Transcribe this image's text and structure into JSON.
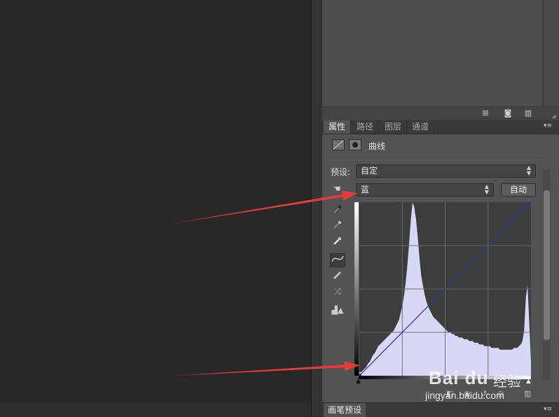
{
  "tabs": [
    {
      "label": "属性",
      "active": true
    },
    {
      "label": "路径",
      "active": false
    },
    {
      "label": "图层",
      "active": false
    },
    {
      "label": "通道",
      "active": false
    }
  ],
  "properties": {
    "title": "曲线",
    "preset_label": "预设:",
    "preset_value": "自定",
    "channel_value": "蓝",
    "auto_button": "自动"
  },
  "bottom_panel": {
    "tab_label": "画笔预设"
  },
  "icons": {
    "top_footer": [
      "new-layer-icon",
      "camera-icon",
      "trash-icon"
    ],
    "tools": [
      "eyedropper-black-icon",
      "eyedropper-gray-icon",
      "eyedropper-white-icon",
      "curve-point-icon",
      "pencil-icon",
      "smooth-icon",
      "clipping-warning-icon"
    ],
    "header": [
      "curves-adjustment-icon",
      "mask-icon"
    ]
  },
  "curve": {
    "channel_color": "#2f2fa0",
    "histogram_color": "#d8d8f6",
    "histogram": [
      2,
      2,
      3,
      4,
      5,
      7,
      8,
      10,
      12,
      13,
      15,
      17,
      18,
      19,
      20,
      21,
      22,
      23,
      24,
      25,
      26,
      28,
      30,
      32,
      36,
      40,
      46,
      54,
      64,
      76,
      90,
      100,
      97,
      90,
      80,
      68,
      58,
      52,
      47,
      43,
      40,
      38,
      36,
      34,
      33,
      32,
      31,
      30,
      29,
      28,
      27,
      26,
      25,
      25,
      24,
      24,
      23,
      23,
      22,
      22,
      22,
      21,
      21,
      21,
      20,
      20,
      20,
      19,
      19,
      19,
      18,
      18,
      18,
      17,
      17,
      17,
      17,
      16,
      16,
      16,
      16,
      16,
      15,
      15,
      15,
      15,
      15,
      15,
      15,
      15,
      16,
      16,
      16,
      17,
      18,
      20,
      26,
      45,
      52,
      30,
      8
    ],
    "points": [
      [
        0,
        0
      ],
      [
        255,
        255
      ]
    ]
  },
  "watermark": {
    "logo": "Bai du",
    "text": "经验",
    "url": "jingyan.baidu.com"
  },
  "annotation_color": "#e43b3b"
}
